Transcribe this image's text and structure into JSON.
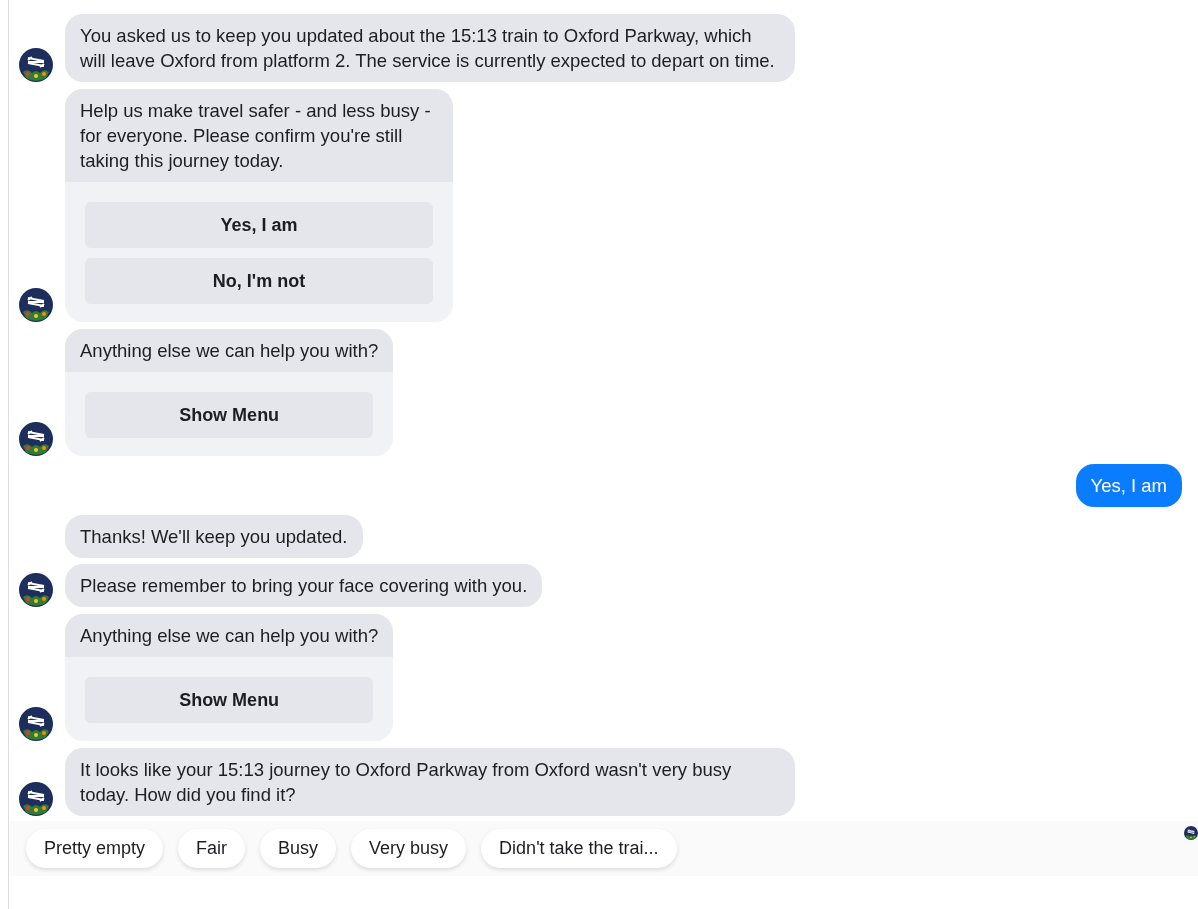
{
  "messages": [
    {
      "kind": "bot",
      "bubbles": [
        {
          "kind": "text",
          "text": "You asked us to keep you updated about the 15:13 train to Oxford Parkway, which will leave Oxford from platform 2. The service is currently expected to depart on time."
        }
      ]
    },
    {
      "kind": "bot",
      "bubbles": [
        {
          "kind": "card",
          "text": "Help us make travel safer - and less busy - for everyone. Please confirm you're still taking this journey today.",
          "buttons": [
            "Yes, I am",
            "No, I'm not"
          ]
        }
      ]
    },
    {
      "kind": "bot",
      "bubbles": [
        {
          "kind": "card",
          "text": "Anything else we can help you with?",
          "buttons": [
            "Show Menu"
          ]
        }
      ]
    },
    {
      "kind": "user",
      "bubbles": [
        {
          "kind": "text",
          "text": "Yes, I am"
        }
      ]
    },
    {
      "kind": "bot",
      "bubbles": [
        {
          "kind": "text",
          "text": "Thanks! We'll keep you updated."
        },
        {
          "kind": "text",
          "text": "Please remember to bring your face covering with you."
        }
      ]
    },
    {
      "kind": "bot",
      "bubbles": [
        {
          "kind": "card",
          "text": "Anything else we can help you with?",
          "buttons": [
            "Show Menu"
          ]
        }
      ]
    },
    {
      "kind": "bot",
      "bubbles": [
        {
          "kind": "text",
          "text": "It looks like your 15:13 journey to Oxford Parkway from Oxford wasn't very busy today. How did you find it?"
        }
      ]
    }
  ],
  "quick_replies": [
    "Pretty empty",
    "Fair",
    "Busy",
    "Very busy",
    "Didn't take the trai..."
  ]
}
